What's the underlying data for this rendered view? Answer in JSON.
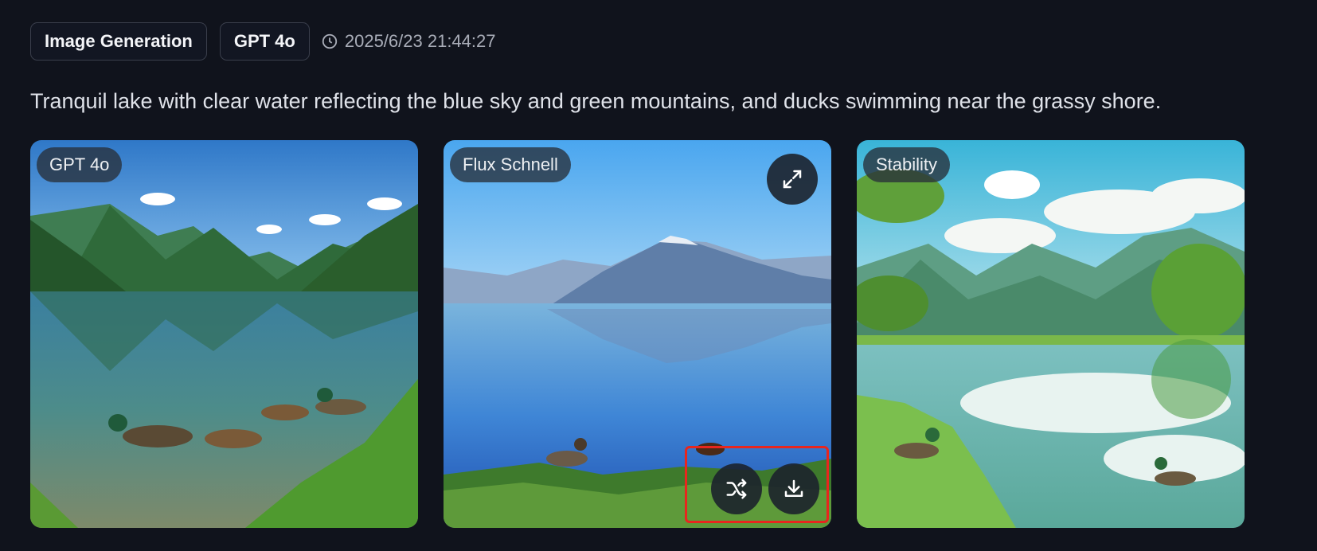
{
  "header": {
    "tag_type": "Image Generation",
    "tag_model": "GPT 4o",
    "timestamp": "2025/6/23 21:44:27",
    "clock_icon": "clock-icon"
  },
  "prompt": "Tranquil lake with clear water reflecting the blue sky and green mountains, and ducks swimming near the grassy shore.",
  "cards": [
    {
      "model": "GPT 4o"
    },
    {
      "model": "Flux Schnell",
      "actions": [
        "expand-icon",
        "shuffle-icon",
        "download-icon"
      ]
    },
    {
      "model": "Stability"
    }
  ],
  "colors": {
    "background": "#10131c",
    "highlight": "#e8261e"
  }
}
